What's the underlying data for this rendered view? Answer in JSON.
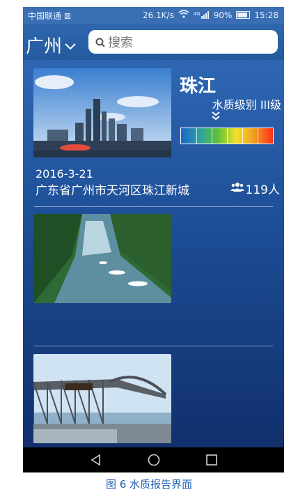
{
  "status_bar": {
    "carrier": "中国联通 ⊠",
    "speed": "26.1K/s",
    "network": "4G",
    "battery": "90%",
    "time": "15:28"
  },
  "header": {
    "city": "广州",
    "search_placeholder": "搜索"
  },
  "reports": [
    {
      "name": "珠江",
      "quality_text": "水质级别 III级",
      "date": "2016-3-21",
      "location": "广东省广州市天河区珠江新城",
      "people": "119人"
    }
  ],
  "caption": "图 6 水质报告界面",
  "colors": {
    "header_blue": "#2f67ad",
    "content_top": "#2f67b3",
    "content_bottom": "#112f6c"
  }
}
